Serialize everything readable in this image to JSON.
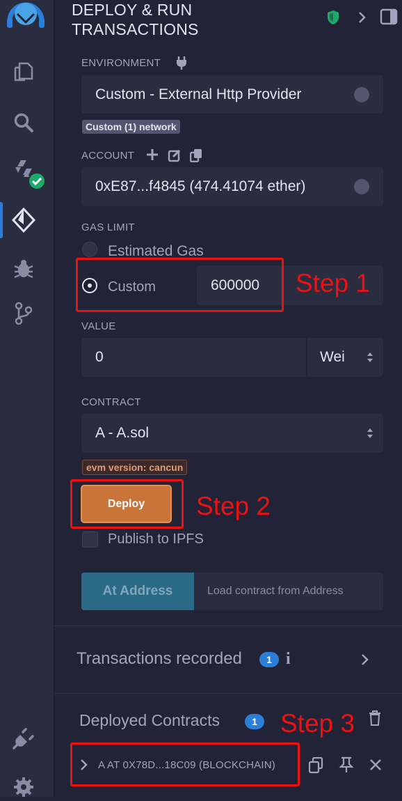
{
  "panel": {
    "title_line1": "DEPLOY & RUN",
    "title_line2": "TRANSACTIONS"
  },
  "environment": {
    "label": "ENVIRONMENT",
    "value": "Custom - External Http Provider",
    "network_badge": "Custom (1) network"
  },
  "account": {
    "label": "ACCOUNT",
    "value": "0xE87...f4845 (474.41074 ether)"
  },
  "gas": {
    "label": "GAS LIMIT",
    "estimated_label": "Estimated Gas",
    "custom_label": "Custom",
    "custom_value": "600000"
  },
  "value": {
    "label": "VALUE",
    "amount": "0",
    "unit": "Wei"
  },
  "contract": {
    "label": "CONTRACT",
    "value": "A - A.sol",
    "evm_badge": "evm version: cancun"
  },
  "deploy": {
    "button_label": "Deploy",
    "publish_label": "Publish to IPFS"
  },
  "at_address": {
    "button_label": "At Address",
    "placeholder": "Load contract from Address"
  },
  "transactions": {
    "label": "Transactions recorded",
    "count": "1",
    "info": "i"
  },
  "deployed": {
    "label": "Deployed Contracts",
    "count": "1",
    "instance_label": "A AT 0X78D...18C09 (BLOCKCHAIN)"
  },
  "annotations": {
    "step1": "Step 1",
    "step2": "Step 2",
    "step3": "Step 3"
  },
  "colors": {
    "background": "#222336",
    "input_bg": "#2a2c3f",
    "deploy_orange": "#c97539",
    "annotation_red": "#ee1111",
    "accent_blue": "#2b7fd8",
    "success_green": "#1aaa6a"
  }
}
